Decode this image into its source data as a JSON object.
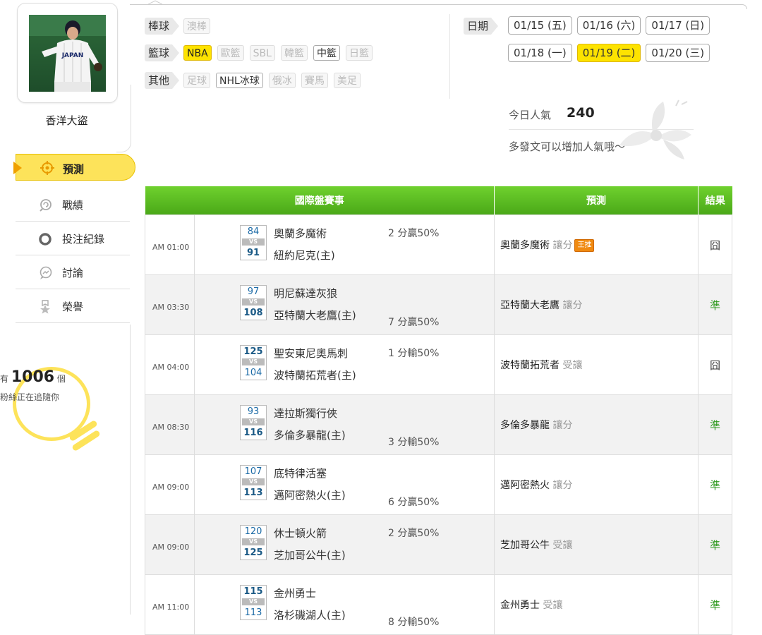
{
  "user": {
    "name": "香洋大盜",
    "avatar_caption": "JAPAN"
  },
  "nav": {
    "items": [
      {
        "label": "預測",
        "icon": "crosshair-icon",
        "active": true
      },
      {
        "label": "戰績",
        "icon": "chart-swirl-icon",
        "active": false
      },
      {
        "label": "投注紀錄",
        "icon": "ring-icon",
        "active": false
      },
      {
        "label": "討論",
        "icon": "chat-icon",
        "active": false
      },
      {
        "label": "榮譽",
        "icon": "medal-icon",
        "active": false
      }
    ]
  },
  "fans": {
    "prefix": "有",
    "count": "1006",
    "suffix": "個",
    "line2": "粉絲正在追隨你"
  },
  "filters": {
    "baseball": {
      "label": "棒球",
      "items": [
        {
          "label": "澳棒",
          "state": "off"
        }
      ]
    },
    "basketball": {
      "label": "籃球",
      "items": [
        {
          "label": "NBA",
          "state": "sel"
        },
        {
          "label": "歐籃",
          "state": "off"
        },
        {
          "label": "SBL",
          "state": "off"
        },
        {
          "label": "韓籃",
          "state": "off"
        },
        {
          "label": "中籃",
          "state": "on"
        },
        {
          "label": "日籃",
          "state": "off"
        }
      ]
    },
    "other": {
      "label": "其他",
      "items": [
        {
          "label": "足球",
          "state": "off"
        },
        {
          "label": "NHL冰球",
          "state": "on"
        },
        {
          "label": "俄冰",
          "state": "off"
        },
        {
          "label": "賽馬",
          "state": "off"
        },
        {
          "label": "美足",
          "state": "off"
        }
      ]
    }
  },
  "dates": {
    "label": "日期",
    "row1": [
      {
        "label": "01/15 (五)",
        "selected": false
      },
      {
        "label": "01/16 (六)",
        "selected": false
      },
      {
        "label": "01/17 (日)",
        "selected": false
      }
    ],
    "row2": [
      {
        "label": "01/18 (一)",
        "selected": false
      },
      {
        "label": "01/19 (二)",
        "selected": true
      },
      {
        "label": "01/20 (三)",
        "selected": false
      }
    ]
  },
  "popularity": {
    "label": "今日人氣",
    "value": "240",
    "tip": "多發文可以增加人氣哦～"
  },
  "table": {
    "headers": {
      "match": "國際盤賽事",
      "prediction": "預測",
      "result": "結果"
    },
    "rows": [
      {
        "time": "AM 01:00",
        "away_score": "84",
        "vs": "VS",
        "home_score": "91",
        "away": "奧蘭多魔術",
        "home": "紐約尼克(主)",
        "line": "2 分贏50%",
        "line_pos": "top",
        "winner": "home",
        "pick": "奧蘭多魔術",
        "pick_type": "讓分",
        "badge": "王推",
        "result": "囧",
        "hit": false
      },
      {
        "time": "AM 03:30",
        "away_score": "97",
        "vs": "VS",
        "home_score": "108",
        "away": "明尼蘇達灰狼",
        "home": "亞特蘭大老鷹(主)",
        "line": "7 分贏50%",
        "line_pos": "bottom",
        "winner": "home",
        "pick": "亞特蘭大老鷹",
        "pick_type": "讓分",
        "badge": "",
        "result": "準",
        "hit": true
      },
      {
        "time": "AM 04:00",
        "away_score": "125",
        "vs": "VS",
        "home_score": "104",
        "away": "聖安東尼奧馬刺",
        "home": "波特蘭拓荒者(主)",
        "line": "1 分輸50%",
        "line_pos": "top",
        "winner": "away",
        "pick": "波特蘭拓荒者",
        "pick_type": "受讓",
        "badge": "",
        "result": "囧",
        "hit": false
      },
      {
        "time": "AM 08:30",
        "away_score": "93",
        "vs": "VS",
        "home_score": "116",
        "away": "達拉斯獨行俠",
        "home": "多倫多暴龍(主)",
        "line": "3 分輸50%",
        "line_pos": "bottom",
        "winner": "home",
        "pick": "多倫多暴龍",
        "pick_type": "讓分",
        "badge": "",
        "result": "準",
        "hit": true
      },
      {
        "time": "AM 09:00",
        "away_score": "107",
        "vs": "VS",
        "home_score": "113",
        "away": "底特律活塞",
        "home": "邁阿密熱火(主)",
        "line": "6 分贏50%",
        "line_pos": "bottom",
        "winner": "home",
        "pick": "邁阿密熱火",
        "pick_type": "讓分",
        "badge": "",
        "result": "準",
        "hit": true
      },
      {
        "time": "AM 09:00",
        "away_score": "120",
        "vs": "VS",
        "home_score": "125",
        "away": "休士頓火箭",
        "home": "芝加哥公牛(主)",
        "line": "2 分贏50%",
        "line_pos": "top",
        "winner": "home",
        "pick": "芝加哥公牛",
        "pick_type": "受讓",
        "badge": "",
        "result": "準",
        "hit": true
      },
      {
        "time": "AM 11:00",
        "away_score": "115",
        "vs": "VS",
        "home_score": "113",
        "away": "金州勇士",
        "home": "洛杉磯湖人(主)",
        "line": "8 分輸50%",
        "line_pos": "bottom",
        "winner": "away",
        "pick": "金州勇士",
        "pick_type": "受讓",
        "badge": "",
        "result": "準",
        "hit": true
      }
    ]
  },
  "colors": {
    "accent_yellow": "#fde300",
    "header_green": "#55b520",
    "hit_green": "#2f9a20",
    "score_blue": "#1b6aa6"
  }
}
